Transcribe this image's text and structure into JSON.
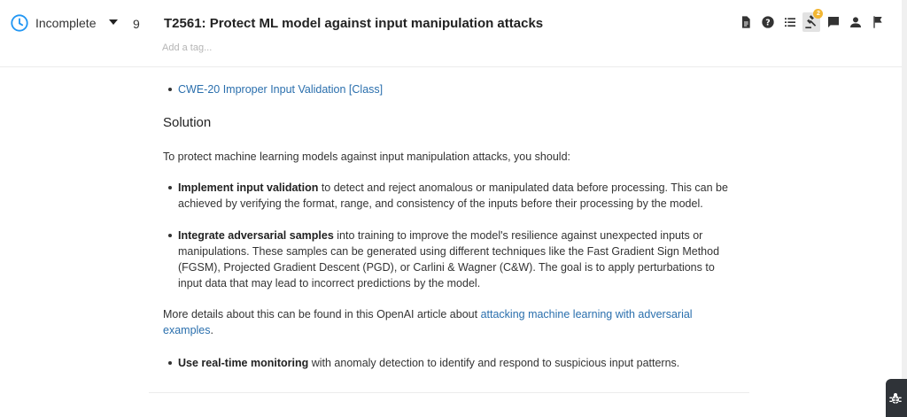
{
  "header": {
    "status_label": "Incomplete",
    "count": "9",
    "title": "T2561: Protect ML model against input manipulation attacks",
    "tag_placeholder": "Add a tag...",
    "notification_count": "2"
  },
  "toolbar": {
    "icons": [
      "document-icon",
      "help-icon",
      "list-icon",
      "gavel-icon",
      "comment-icon",
      "person-icon",
      "flag-icon"
    ]
  },
  "colors": {
    "accent": "#2196f3",
    "link": "#2a6fad",
    "badge": "#f2b632"
  },
  "content": {
    "cwe_link": "CWE-20 Improper Input Validation [Class]",
    "solution_heading": "Solution",
    "intro": "To protect machine learning models against input manipulation attacks, you should:",
    "bullets": [
      {
        "bold": "Implement input validation",
        "text": " to detect and reject anomalous or manipulated data before processing. This can be achieved by verifying the format, range, and consistency of the inputs before their processing by the model."
      },
      {
        "bold": "Integrate adversarial samples",
        "text": " into training to improve the model's resilience against unexpected inputs or manipulations. These samples can be generated using different techniques like the Fast Gradient Sign Method (FGSM), Projected Gradient Descent (PGD), or Carlini & Wagner (C&W). The goal is to apply perturbations to input data that may lead to incorrect predictions by the model."
      }
    ],
    "more_prefix": "More details about this can be found in this OpenAI article about ",
    "more_link": "attacking machine learning with adversarial examples",
    "more_suffix": ".",
    "final_bullet": {
      "bold": "Use real-time monitoring",
      "text": " with anomaly detection to identify and respond to suspicious input patterns."
    }
  }
}
